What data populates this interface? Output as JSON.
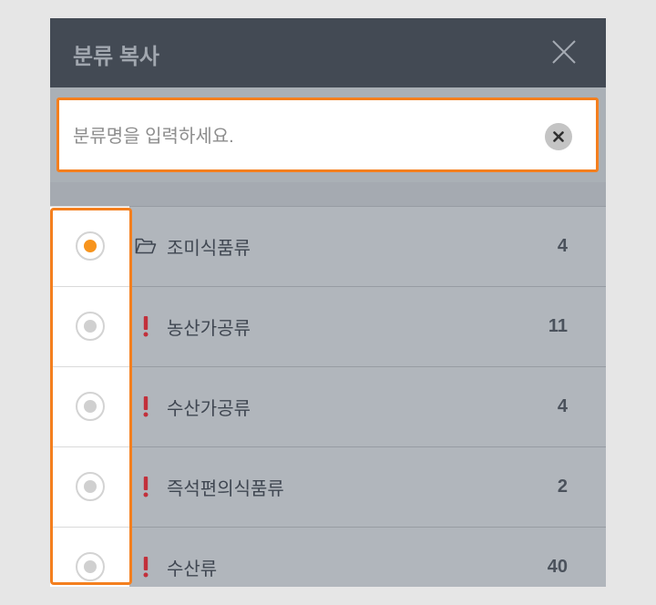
{
  "dialog": {
    "title": "분류 복사",
    "close_icon": "close-icon"
  },
  "search": {
    "value": "",
    "placeholder": "분류명을 입력하세요.",
    "clear_icon": "clear-icon"
  },
  "categories": [
    {
      "label": "조미식품류",
      "count": 4,
      "icon": "folder-open-icon",
      "selected": true
    },
    {
      "label": "농산가공류",
      "count": 11,
      "icon": "alert-icon",
      "selected": false
    },
    {
      "label": "수산가공류",
      "count": 4,
      "icon": "alert-icon",
      "selected": false
    },
    {
      "label": "즉석편의식품류",
      "count": 2,
      "icon": "alert-icon",
      "selected": false
    },
    {
      "label": "수산류",
      "count": 40,
      "icon": "alert-icon",
      "selected": false
    }
  ],
  "colors": {
    "header": "#434a54",
    "highlight": "#f47f1e",
    "selected_radio": "#f7941d",
    "alert": "#c2303b",
    "list_background": "#b1b6bc"
  }
}
